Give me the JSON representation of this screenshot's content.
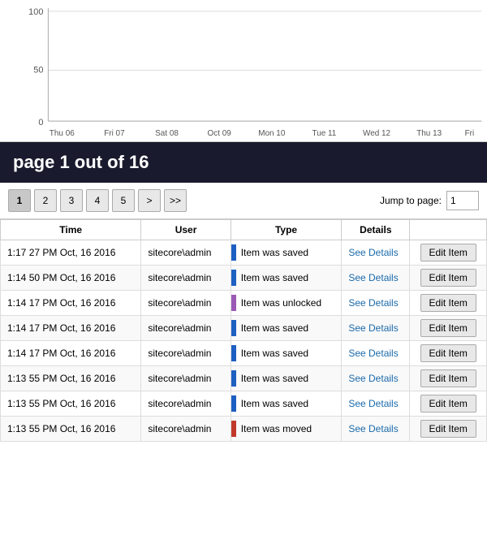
{
  "chart": {
    "y_labels": [
      "100",
      "50",
      "0"
    ],
    "x_labels": [
      "Thu 06",
      "Fri 07",
      "Sat 08",
      "Oct 09",
      "Mon 10",
      "Tue 11",
      "Wed 12",
      "Thu 13",
      "Fri"
    ],
    "height": 175,
    "y_max": 100
  },
  "header": {
    "title": "page 1 out of 16"
  },
  "pagination": {
    "current_page": 1,
    "total_pages": 16,
    "buttons": [
      "1",
      "2",
      "3",
      "4",
      "5"
    ],
    "next_label": ">",
    "last_label": ">>",
    "jump_label": "Jump to page:",
    "jump_value": "1"
  },
  "table": {
    "headers": [
      "Time",
      "User",
      "Type",
      "Details",
      ""
    ],
    "rows": [
      {
        "time": "1:17 27 PM Oct, 16 2016",
        "user": "sitecore\\admin",
        "type": "Item was saved",
        "bar_color": "bar-blue",
        "details_link": "See Details",
        "action_label": "Edit Item"
      },
      {
        "time": "1:14 50 PM Oct, 16 2016",
        "user": "sitecore\\admin",
        "type": "Item was saved",
        "bar_color": "bar-blue",
        "details_link": "See Details",
        "action_label": "Edit Item"
      },
      {
        "time": "1:14 17 PM Oct, 16 2016",
        "user": "sitecore\\admin",
        "type": "Item was unlocked",
        "bar_color": "bar-purple",
        "details_link": "See Details",
        "action_label": "Edit Item"
      },
      {
        "time": "1:14 17 PM Oct, 16 2016",
        "user": "sitecore\\admin",
        "type": "Item was saved",
        "bar_color": "bar-blue",
        "details_link": "See Details",
        "action_label": "Edit Item"
      },
      {
        "time": "1:14 17 PM Oct, 16 2016",
        "user": "sitecore\\admin",
        "type": "Item was saved",
        "bar_color": "bar-blue",
        "details_link": "See Details",
        "action_label": "Edit Item"
      },
      {
        "time": "1:13 55 PM Oct, 16 2016",
        "user": "sitecore\\admin",
        "type": "Item was saved",
        "bar_color": "bar-blue",
        "details_link": "See Details",
        "action_label": "Edit Item"
      },
      {
        "time": "1:13 55 PM Oct, 16 2016",
        "user": "sitecore\\admin",
        "type": "Item was saved",
        "bar_color": "bar-blue",
        "details_link": "See Details",
        "action_label": "Edit Item"
      },
      {
        "time": "1:13 55 PM Oct, 16 2016",
        "user": "sitecore\\admin",
        "type": "Item was moved",
        "bar_color": "bar-red",
        "details_link": "See Details",
        "action_label": "Edit Item"
      }
    ]
  }
}
